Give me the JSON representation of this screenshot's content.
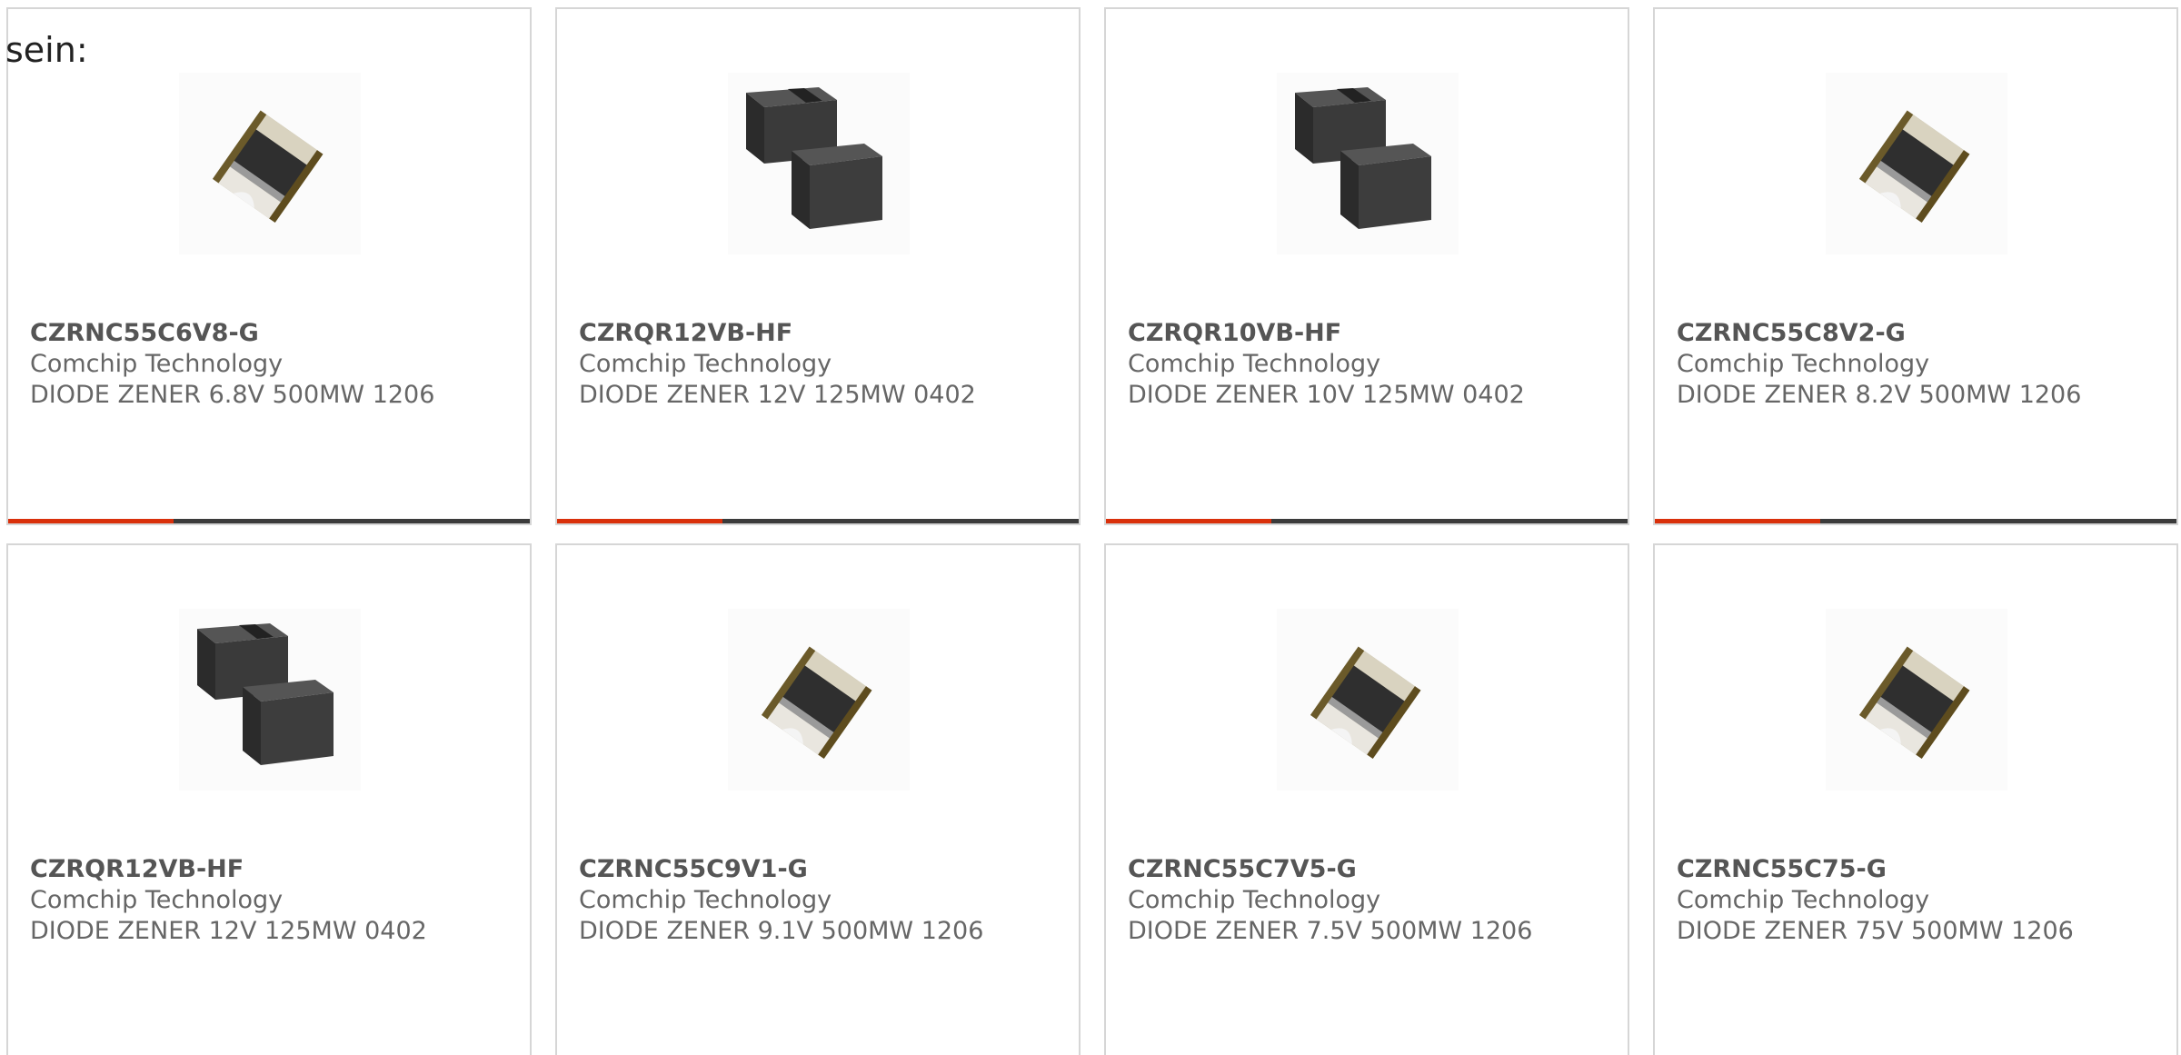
{
  "intro_text": "sein:",
  "products": [
    {
      "part_number": "CZRNC55C6V8-G",
      "manufacturer": "Comchip Technology",
      "description": "DIODE ZENER 6.8V 500MW 1206",
      "image_icon": "smd-chip-image"
    },
    {
      "part_number": "CZRQR12VB-HF",
      "manufacturer": "Comchip Technology",
      "description": "DIODE ZENER 12V 125MW 0402",
      "image_icon": "smd-block-image"
    },
    {
      "part_number": "CZRQR10VB-HF",
      "manufacturer": "Comchip Technology",
      "description": "DIODE ZENER 10V 125MW 0402",
      "image_icon": "smd-block-image"
    },
    {
      "part_number": "CZRNC55C8V2-G",
      "manufacturer": "Comchip Technology",
      "description": "DIODE ZENER 8.2V 500MW 1206",
      "image_icon": "smd-chip-image"
    },
    {
      "part_number": "CZRQR12VB-HF",
      "manufacturer": "Comchip Technology",
      "description": "DIODE ZENER 12V 125MW 0402",
      "image_icon": "smd-block-image"
    },
    {
      "part_number": "CZRNC55C9V1-G",
      "manufacturer": "Comchip Technology",
      "description": "DIODE ZENER 9.1V 500MW 1206",
      "image_icon": "smd-chip-image"
    },
    {
      "part_number": "CZRNC55C7V5-G",
      "manufacturer": "Comchip Technology",
      "description": "DIODE ZENER 7.5V 500MW 1206",
      "image_icon": "smd-chip-image"
    },
    {
      "part_number": "CZRNC55C75-G",
      "manufacturer": "Comchip Technology",
      "description": "DIODE ZENER 75V 500MW 1206",
      "image_icon": "smd-chip-image"
    }
  ],
  "colors": {
    "accent": "#d9300b",
    "bar": "#3b3b3b",
    "border": "#d6d6d6",
    "text": "#666666"
  }
}
